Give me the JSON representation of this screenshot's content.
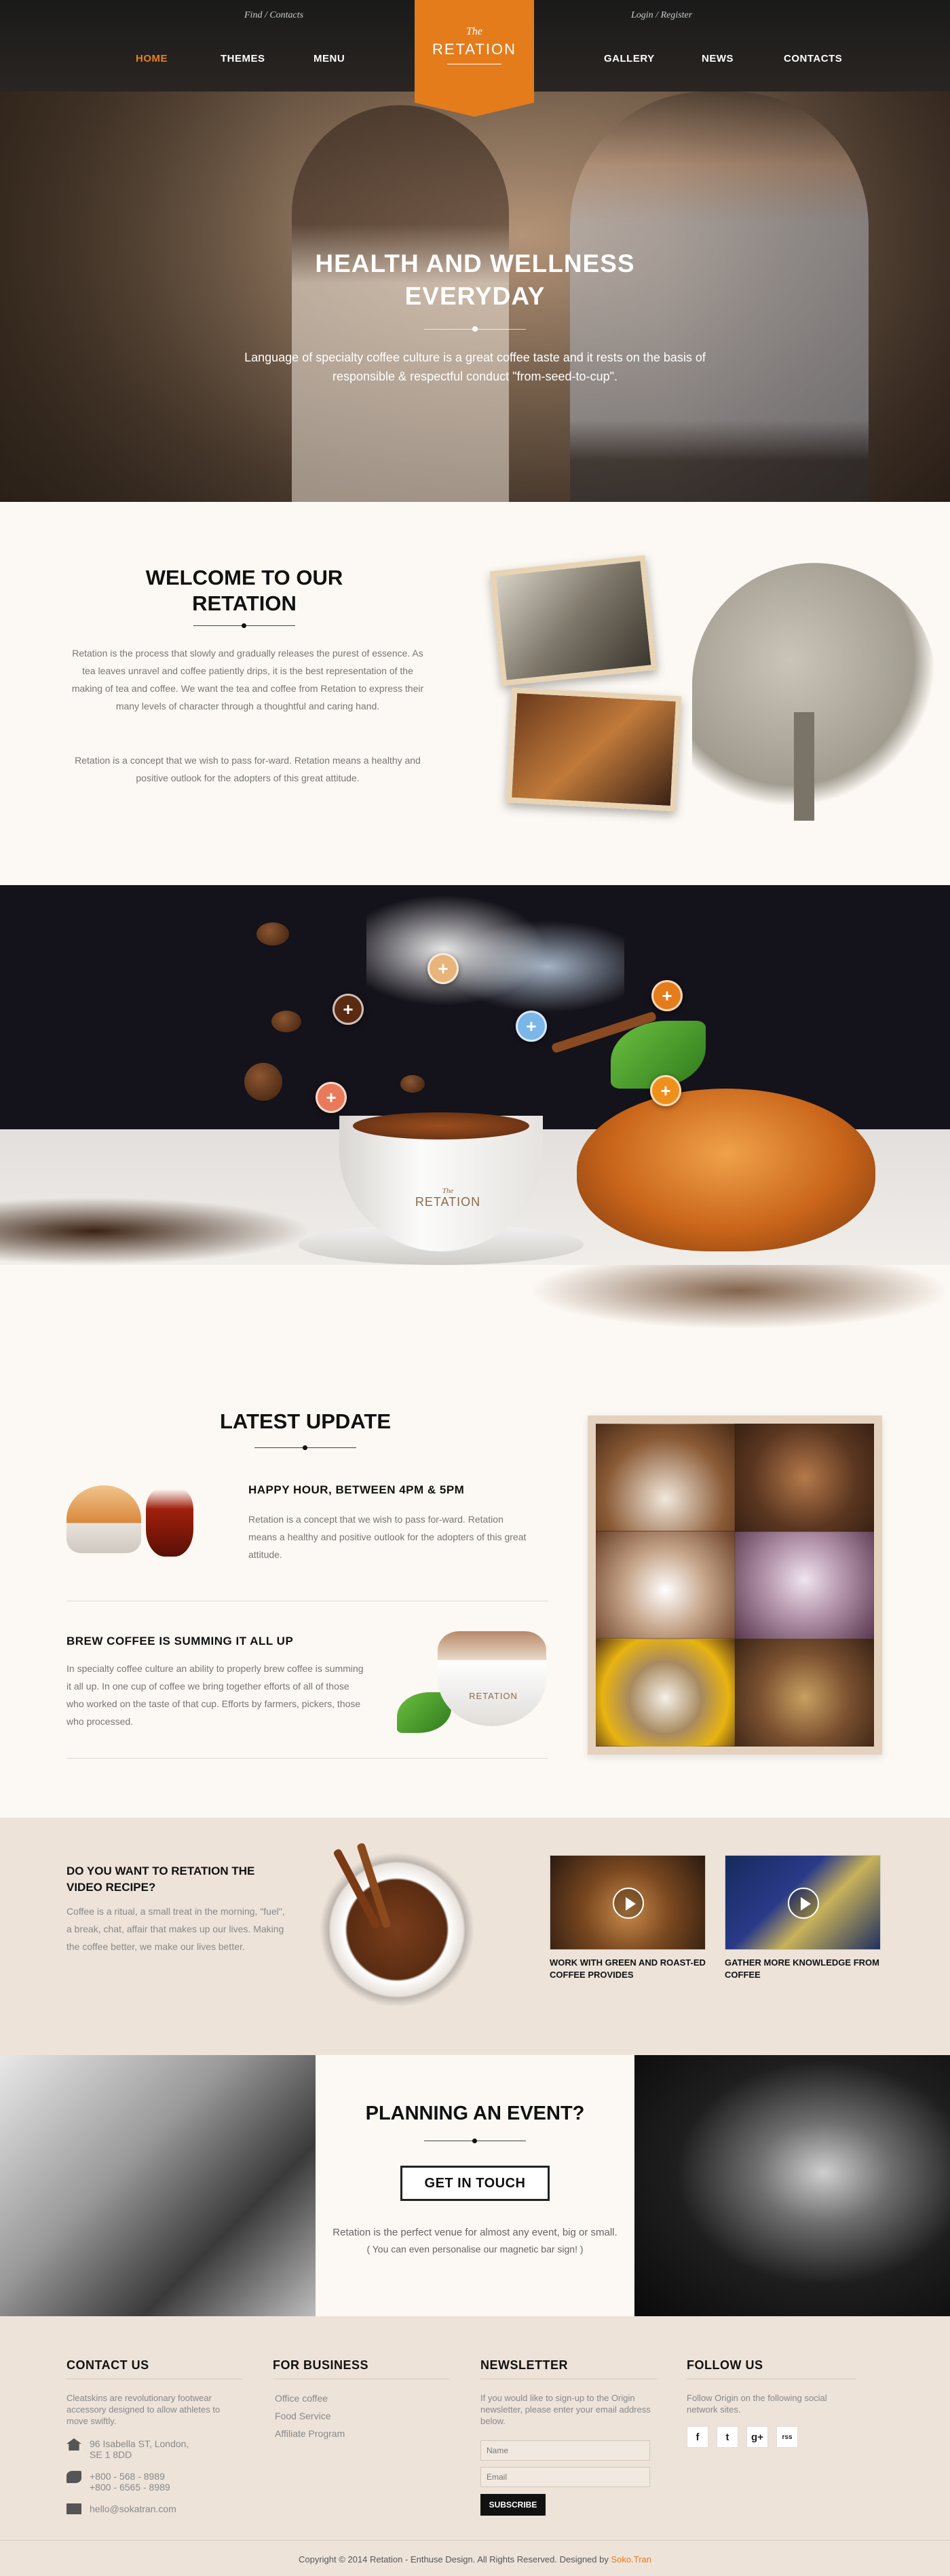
{
  "header": {
    "topbar_left": "Find / Contacts",
    "topbar_right": "Login / Register",
    "nav": [
      {
        "label": "HOME",
        "active": true
      },
      {
        "label": "THEMES"
      },
      {
        "label": "MENU"
      },
      {
        "label": "GALLERY"
      },
      {
        "label": "NEWS"
      },
      {
        "label": "CONTACTS"
      }
    ],
    "logo": {
      "the": "The",
      "name": "RETATION"
    }
  },
  "hero": {
    "title_line1": "HEALTH AND WELLNESS",
    "title_line2": "EVERYDAY",
    "text": "Language of specialty coffee culture is a great coffee taste and it rests on the basis of responsible & respectful conduct \"from-seed-to-cup\"."
  },
  "welcome": {
    "title": "WELCOME TO OUR RETATION",
    "p1": "Retation is the process that slowly and gradually releases the purest of essence. As tea leaves unravel and coffee patiently drips, it is the best representation of the making of tea and coffee. We want the tea and coffee from Retation to express their many levels of character through a thoughtful and caring hand.",
    "p2": "Retation is a concept that we wish to pass for-ward. Retation means a healthy and positive outlook for the adopters of this great attitude."
  },
  "ingredients": {
    "cup_logo_the": "The",
    "cup_logo_name": "RETATION",
    "hotspot_symbol": "+"
  },
  "latest": {
    "title": "LATEST UPDATE",
    "post1": {
      "title": "HAPPY HOUR, BETWEEN 4PM & 5PM",
      "text": "Retation is a concept that we wish to pass for-ward. Retation means a healthy and positive outlook for the adopters of this great attitude."
    },
    "post2": {
      "title": "BREW COFFEE IS SUMMING IT ALL UP",
      "text": "In specialty coffee culture an ability to properly brew coffee is summing it all up. In one cup of coffee we bring together efforts of all of those who worked on the taste of that cup. Efforts by farmers, pickers, those who processed."
    },
    "cup_logo": "RETATION"
  },
  "video": {
    "title": "DO YOU WANT TO RETATION THE VIDEO RECIPE?",
    "text": "Coffee is a ritual, a small treat in the morning, \"fuel\", a break, chat, affair that makes up our lives. Making the coffee better, we make our lives better.",
    "thumb1_caption": "WORK WITH GREEN AND ROAST-ED COFFEE PROVIDES",
    "thumb2_caption": "GATHER MORE KNOWLEDGE FROM COFFEE"
  },
  "event": {
    "title": "PLANNING AN EVENT?",
    "button": "GET IN TOUCH",
    "text1": "Retation is the perfect venue for almost any event, big or small.",
    "text2": "( You can even personalise our magnetic bar sign! )"
  },
  "footer": {
    "contact": {
      "title": "CONTACT US",
      "text": "Cleatskins are revolutionary footwear accessory designed to allow athletes to move swiftly.",
      "address_line1": "96 Isabella ST, London,",
      "address_line2": "SE 1 8DD",
      "phone1": "+800 - 568 - 8989",
      "phone2": "+800 - 6565 - 8989",
      "email": "hello@sokatran.com"
    },
    "business": {
      "title": "FOR BUSINESS",
      "links": [
        "Office coffee",
        "Food Service",
        "Affiliate Program"
      ]
    },
    "newsletter": {
      "title": "NEWSLETTER",
      "text": "If you would like to sign-up to the Origin newsletter, please enter your email address below.",
      "name_placeholder": "Name",
      "email_placeholder": "Email",
      "button": "SUBSCRIBE"
    },
    "follow": {
      "title": "FOLLOW US",
      "text": "Follow Origin on the following social network sites.",
      "icons": [
        "f",
        "t",
        "g+",
        "rss"
      ]
    },
    "copyright": "Copyright © 2014 Retation - Enthuse Design. All Rights Reserved. Designed by",
    "designer": "Soko.Tran"
  },
  "colors": {
    "accent": "#e47c1c",
    "dark": "#111111",
    "cream": "#fcf8f3",
    "beige": "#ede3d9"
  }
}
